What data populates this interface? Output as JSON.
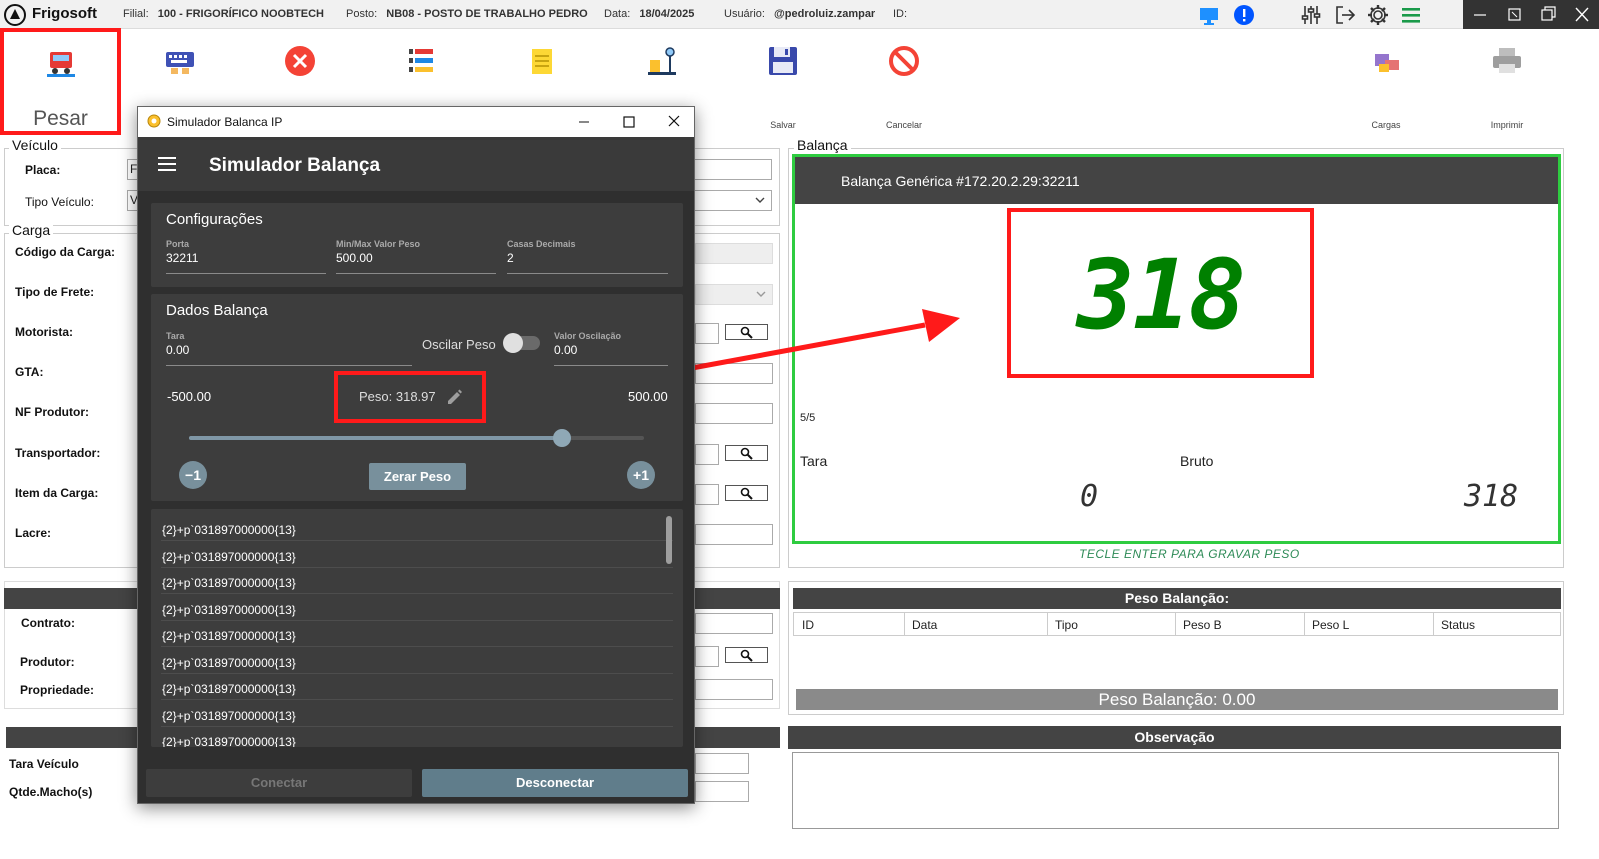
{
  "topbar": {
    "brand": "Frigosoft",
    "filial_label": "Filial:",
    "filial_value": "100 - FRIGORÍFICO NOOBTECH",
    "posto_label": "Posto:",
    "posto_value": "NB08 - POSTO DE TRABALHO PEDRO",
    "data_label": "Data:",
    "data_value": "18/04/2025",
    "usuario_label": "Usuário:",
    "usuario_value": "@pedroluiz.zampar",
    "id_label": "ID:"
  },
  "ribbon": {
    "pesar_label": "Pesar",
    "salvar_label": "Salvar",
    "cancelar_label": "Cancelar",
    "cargas_label": "Cargas",
    "imprimir_label": "Imprimir"
  },
  "form": {
    "veiculo_legend": "Veículo",
    "placa_label": "Placa:",
    "placa_value": "F",
    "tipo_veiculo_label": "Tipo Veículo:",
    "tipo_veiculo_value": "V",
    "carga_legend": "Carga",
    "codigo_carga_label": "Código da Carga:",
    "tipo_frete_label": "Tipo de Frete:",
    "motorista_label": "Motorista:",
    "gta_label": "GTA:",
    "nf_produtor_label": "NF Produtor:",
    "transportador_label": "Transportador:",
    "item_carga_label": "Item da Carga:",
    "lacre_label": "Lacre:",
    "contrato_label": "Contrato:",
    "produtor_label": "Produtor:",
    "propriedade_label": "Propriedade:",
    "tara_veiculo_label": "Tara Veículo",
    "qtde_macho_label": "Qtde.Macho(s)"
  },
  "balanca": {
    "legend": "Balança",
    "header": "Balança Genérica  #172.20.2.29:32211",
    "display_value": "318",
    "counter": "5/5",
    "tara_label": "Tara",
    "bruto_label": "Bruto",
    "tara_value": "0",
    "bruto_value": "318",
    "hint": "TECLE ENTER PARA GRAVAR PESO"
  },
  "peso_balancao": {
    "title": "Peso Balanção:",
    "columns": [
      "ID",
      "Data",
      "Tipo",
      "Peso B",
      "Peso L",
      "Status"
    ],
    "total_label": "Peso Balanção:  0.00"
  },
  "observacao": {
    "title": "Observação"
  },
  "simulator": {
    "window_title": "Simulador Balanca IP",
    "app_title": "Simulador Balança",
    "config_title": "Configurações",
    "porta_label": "Porta",
    "porta_value": "32211",
    "minmax_label": "Min/Max Valor Peso",
    "minmax_value": "500.00",
    "casas_label": "Casas Decimais",
    "casas_value": "2",
    "dados_title": "Dados Balança",
    "tara_label": "Tara",
    "tara_value": "0.00",
    "oscilar_label": "Oscilar Peso",
    "valor_osc_label": "Valor Oscilação",
    "valor_osc_value": "0.00",
    "min_value": "-500.00",
    "max_value": "500.00",
    "peso_label": "Peso: 318.97",
    "slider_fraction": 0.82,
    "minus_label": "−1",
    "plus_label": "+1",
    "zerar_label": "Zerar Peso",
    "log": [
      "{2}+p`031897000000{13}",
      "{2}+p`031897000000{13}",
      "{2}+p`031897000000{13}",
      "{2}+p`031897000000{13}",
      "{2}+p`031897000000{13}",
      "{2}+p`031897000000{13}",
      "{2}+p`031897000000{13}",
      "{2}+p`031897000000{13}"
    ],
    "conectar_label": "Conectar",
    "desconectar_label": "Desconectar"
  },
  "colors": {
    "highlight": "#ff1a1a",
    "display_green": "#008000",
    "panel_border": "#2ecc40",
    "sim_bg": "#2f2f2f",
    "sim_accent": "#607d8b"
  }
}
